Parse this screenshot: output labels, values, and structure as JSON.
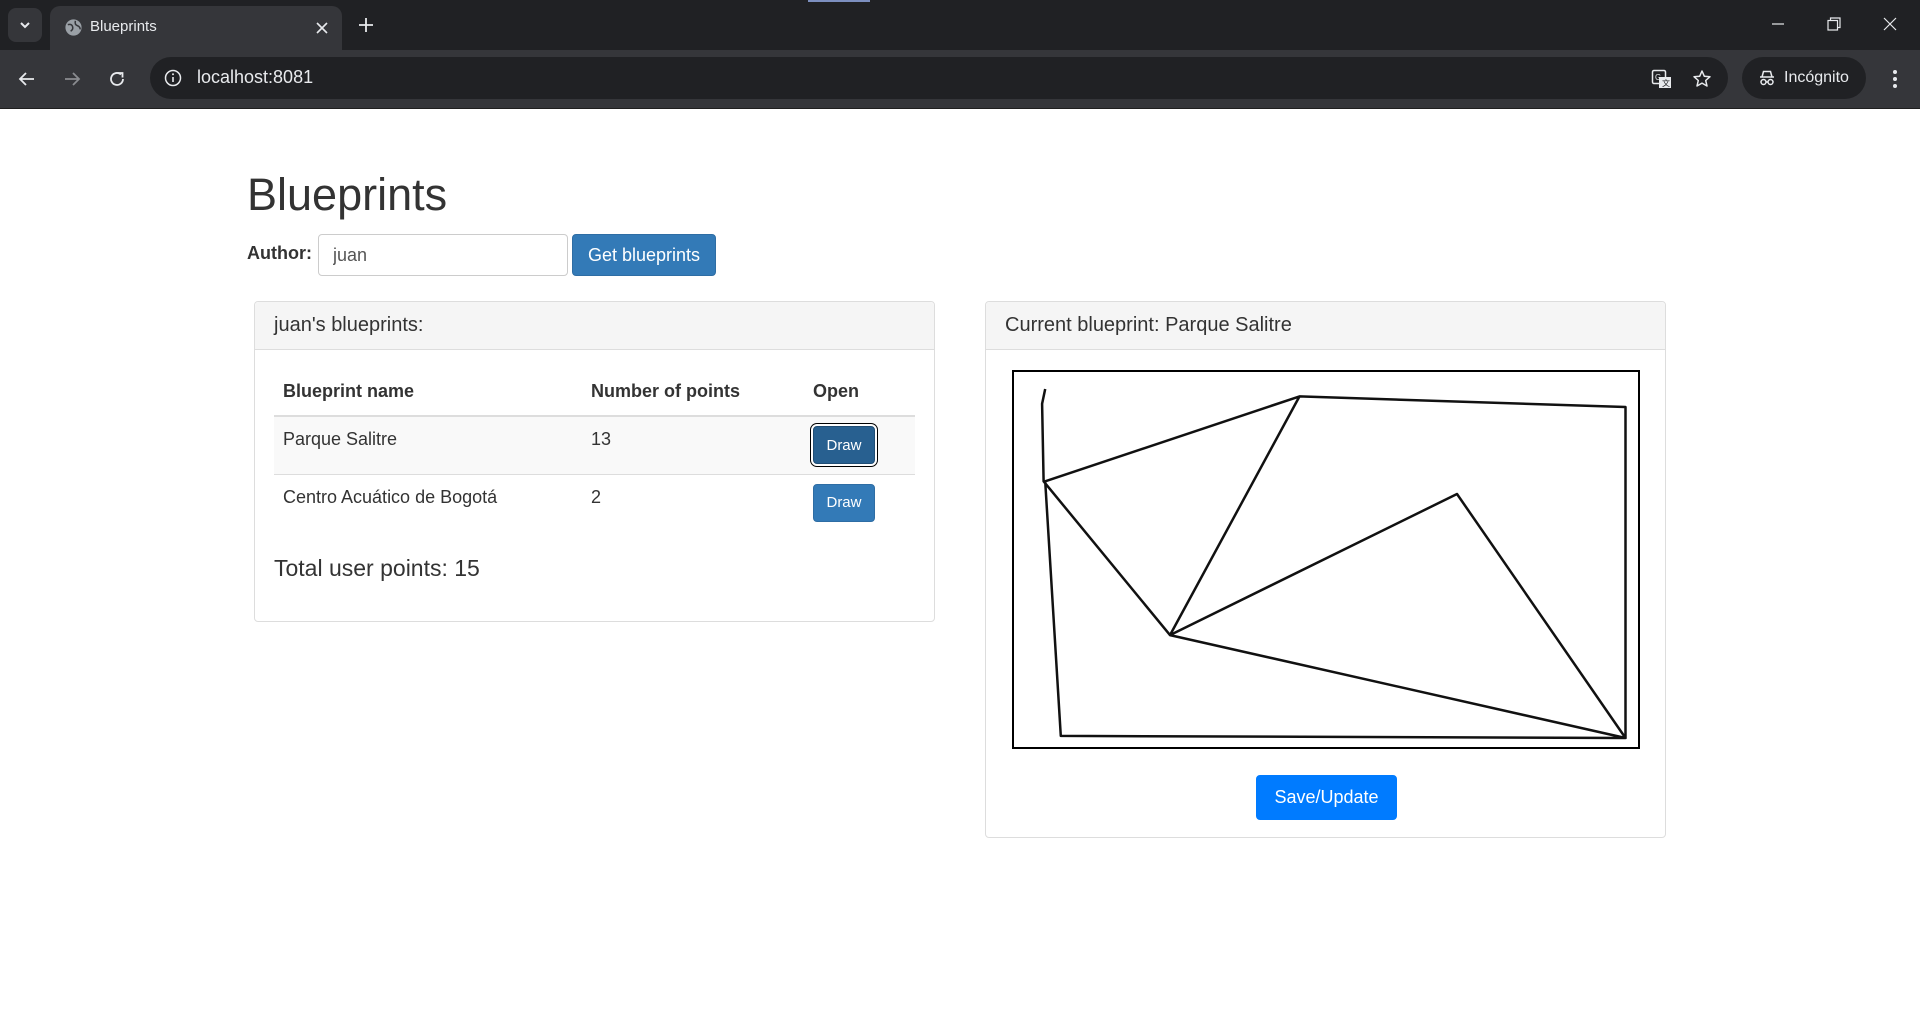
{
  "browser": {
    "tab": {
      "title": "Blueprints",
      "favicon": "globe-icon"
    },
    "url": "localhost:8081",
    "incognito_label": "Incógnito"
  },
  "page": {
    "title": "Blueprints",
    "author": {
      "label": "Author:",
      "value": "juan"
    },
    "get_button_label": "Get blueprints",
    "list_panel": {
      "heading": "juan's blueprints:",
      "columns": [
        "Blueprint name",
        "Number of points",
        "Open"
      ],
      "rows": [
        {
          "name": "Parque Salitre",
          "points": "13",
          "action": "Draw"
        },
        {
          "name": "Centro Acuático de Bogotá",
          "points": "2",
          "action": "Draw"
        }
      ],
      "total": "Total user points: 15"
    },
    "current_panel": {
      "heading": "Current blueprint: Parque Salitre",
      "save_label": "Save/Update"
    }
  },
  "canvas_drawing": {
    "description_key": "Parque Salitre",
    "points": [
      [
        20,
        16
      ],
      [
        18,
        30
      ],
      [
        19,
        103
      ],
      [
        100,
        248
      ],
      [
        284,
        115
      ],
      [
        392,
        345
      ],
      [
        100,
        248
      ],
      [
        183,
        23
      ],
      [
        20,
        103
      ],
      [
        183,
        23
      ],
      [
        392,
        33
      ],
      [
        392,
        345
      ],
      [
        30,
        343
      ],
      [
        20,
        103
      ]
    ]
  }
}
